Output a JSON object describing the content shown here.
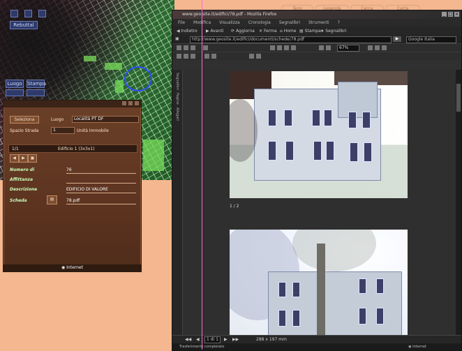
{
  "map": {
    "buttons": [
      "Rebuttal",
      "Luogo",
      "Stampa"
    ]
  },
  "top_tabs": [
    "Temi",
    "Legenda",
    "Cerca",
    "Carta"
  ],
  "panel": {
    "button": "Seleziona",
    "search_label": "Luogo",
    "search_value": "Località PT DF",
    "row2_label": "Spazio Strada",
    "row2_value": "1",
    "row2_right": "Unità Immobile",
    "results_count": "1/1",
    "results_title": "Edificio 1 (3x3x1)",
    "fields": [
      {
        "label": "Numero di",
        "value": "76"
      },
      {
        "label": "Affittanza",
        "value": ""
      },
      {
        "label": "Descrizione",
        "value": "EDIFICIO DI VALORE"
      },
      {
        "label": "Scheda",
        "value": "78.pdf"
      }
    ],
    "status": "Internet"
  },
  "browser": {
    "title": "www.geo.site.it/edifici/78.pdf - Mozilla Firefox",
    "menu": [
      "File",
      "Modifica",
      "Visualizza",
      "Cronologia",
      "Segnalibri",
      "Strumenti",
      "?"
    ],
    "nav": [
      "Indietro",
      "Avanti",
      "Aggiorna",
      "Ferma",
      "Home",
      "Stampa",
      "Segnalibri"
    ],
    "url": "http://www.geosite.it/edifici/documenti/schede/78.pdf",
    "search_placeholder": "Google Italia",
    "zoom": "67%",
    "side_tabs": [
      "Segnalibri",
      "Pagine",
      "Allegati"
    ],
    "page_label": "1 / 2",
    "bottom_page": "1 di 1",
    "bottom_zoom": "288 x 197 mm",
    "status_left": "Trasferimento completato",
    "status_right": "Internet"
  },
  "colors": {
    "background": "#f4b78f",
    "panel": "#6b4028",
    "pink_line": "#ff6ad0",
    "map_highlight": "#2a4bff"
  }
}
